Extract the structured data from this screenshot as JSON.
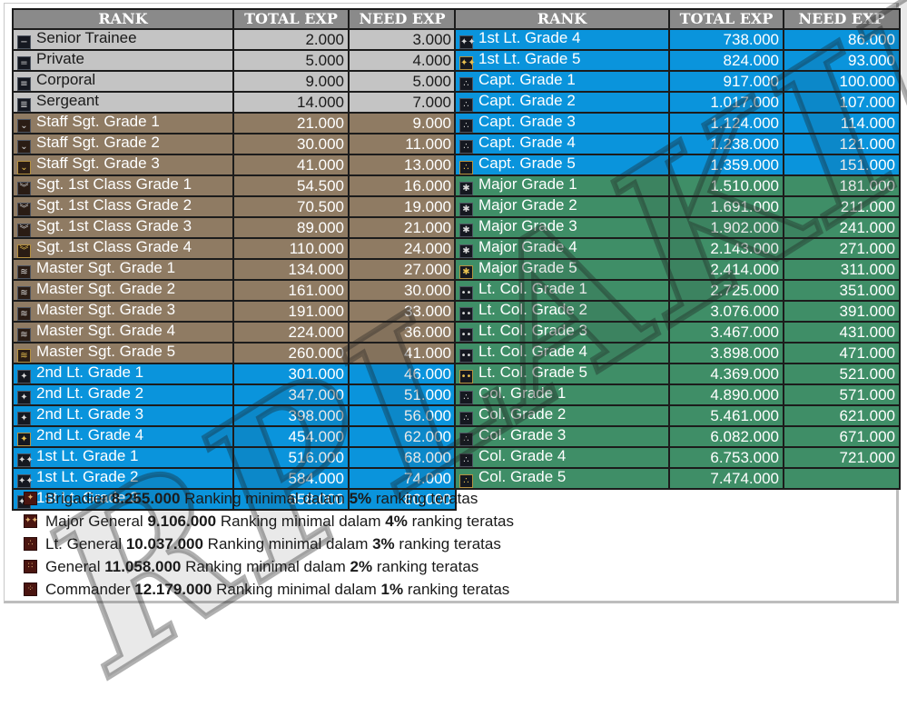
{
  "headers": {
    "rank": "RANK",
    "total_exp": "TOTAL EXP",
    "need_exp": "NEED EXP"
  },
  "colors": {
    "header": "#8a8a8a",
    "enlisted": "#c4c4c4",
    "nco": "#8f7b63",
    "officer": "#0a94dc",
    "field_officer": "#3f8e67",
    "general_icon": "#4a1510"
  },
  "left_table": [
    {
      "rank": "Senior Trainee",
      "total": "2.000",
      "need": "3.000",
      "group": "gray",
      "icon": "bar-1-icon",
      "glyph": "−"
    },
    {
      "rank": "Private",
      "total": "5.000",
      "need": "4.000",
      "group": "gray",
      "icon": "bar-2-icon",
      "glyph": "="
    },
    {
      "rank": "Corporal",
      "total": "9.000",
      "need": "5.000",
      "group": "gray",
      "icon": "bar-3-icon",
      "glyph": "≡"
    },
    {
      "rank": "Sergeant",
      "total": "14.000",
      "need": "7.000",
      "group": "gray",
      "icon": "bar-4-icon",
      "glyph": "≣"
    },
    {
      "rank": "Staff Sgt. Grade 1",
      "total": "21.000",
      "need": "9.000",
      "group": "brown",
      "icon": "chevron-1-icon",
      "glyph": "⌄"
    },
    {
      "rank": "Staff Sgt. Grade 2",
      "total": "30.000",
      "need": "11.000",
      "group": "brown",
      "icon": "chevron-1-icon",
      "glyph": "⌄"
    },
    {
      "rank": "Staff Sgt. Grade 3",
      "total": "41.000",
      "need": "13.000",
      "group": "brown",
      "icon": "chevron-1-gold-icon",
      "glyph": "⌄"
    },
    {
      "rank": "Sgt. 1st Class Grade 1",
      "total": "54.500",
      "need": "16.000",
      "group": "brown",
      "icon": "chevron-2-icon",
      "glyph": "︾"
    },
    {
      "rank": "Sgt. 1st Class Grade 2",
      "total": "70.500",
      "need": "19.000",
      "group": "brown",
      "icon": "chevron-2-icon",
      "glyph": "︾"
    },
    {
      "rank": "Sgt. 1st Class Grade 3",
      "total": "89.000",
      "need": "21.000",
      "group": "brown",
      "icon": "chevron-2-icon",
      "glyph": "︾"
    },
    {
      "rank": "Sgt. 1st Class Grade 4",
      "total": "110.000",
      "need": "24.000",
      "group": "brown",
      "icon": "chevron-2-gold-icon",
      "glyph": "︾"
    },
    {
      "rank": "Master Sgt. Grade 1",
      "total": "134.000",
      "need": "27.000",
      "group": "brown",
      "icon": "chevron-3-icon",
      "glyph": "≋"
    },
    {
      "rank": "Master Sgt. Grade 2",
      "total": "161.000",
      "need": "30.000",
      "group": "brown",
      "icon": "chevron-3-icon",
      "glyph": "≋"
    },
    {
      "rank": "Master Sgt. Grade 3",
      "total": "191.000",
      "need": "33.000",
      "group": "brown",
      "icon": "chevron-3-icon",
      "glyph": "≋"
    },
    {
      "rank": "Master Sgt. Grade 4",
      "total": "224.000",
      "need": "36.000",
      "group": "brown",
      "icon": "chevron-3-icon",
      "glyph": "≋"
    },
    {
      "rank": "Master Sgt. Grade 5",
      "total": "260.000",
      "need": "41.000",
      "group": "brown",
      "icon": "chevron-3-gold-icon",
      "glyph": "≋"
    },
    {
      "rank": "2nd Lt. Grade 1",
      "total": "301.000",
      "need": "46.000",
      "group": "blue",
      "icon": "star-1-icon",
      "glyph": "✦"
    },
    {
      "rank": "2nd Lt. Grade 2",
      "total": "347.000",
      "need": "51.000",
      "group": "blue",
      "icon": "star-1-icon",
      "glyph": "✦"
    },
    {
      "rank": "2nd Lt. Grade 3",
      "total": "398.000",
      "need": "56.000",
      "group": "blue",
      "icon": "star-1-icon",
      "glyph": "✦"
    },
    {
      "rank": "2nd Lt. Grade 4",
      "total": "454.000",
      "need": "62.000",
      "group": "blue",
      "icon": "star-1-gold-icon",
      "glyph": "✦"
    },
    {
      "rank": "1st Lt. Grade 1",
      "total": "516.000",
      "need": "68.000",
      "group": "blue",
      "icon": "star-2-icon",
      "glyph": "✦✦"
    },
    {
      "rank": "1st Lt. Grade 2",
      "total": "584.000",
      "need": "74.000",
      "group": "blue",
      "icon": "star-2-icon",
      "glyph": "✦✦"
    },
    {
      "rank": "1st Lt. Grade 3",
      "total": "658.000",
      "need": "80.000",
      "group": "blue",
      "icon": "star-2-icon",
      "glyph": "✦✦"
    }
  ],
  "right_table": [
    {
      "rank": "1st Lt. Grade 4",
      "total": "738.000",
      "need": "86.000",
      "group": "blue",
      "icon": "star-2-icon",
      "glyph": "✦✦"
    },
    {
      "rank": "1st Lt. Grade 5",
      "total": "824.000",
      "need": "93.000",
      "group": "blue",
      "icon": "star-2-gold-icon",
      "glyph": "✦✦"
    },
    {
      "rank": "Capt. Grade 1",
      "total": "917.000",
      "need": "100.000",
      "group": "blue",
      "icon": "star-3-icon",
      "glyph": "∴"
    },
    {
      "rank": "Capt. Grade 2",
      "total": "1.017.000",
      "need": "107.000",
      "group": "blue",
      "icon": "star-3-icon",
      "glyph": "∴"
    },
    {
      "rank": "Capt. Grade 3",
      "total": "1.124.000",
      "need": "114.000",
      "group": "blue",
      "icon": "star-3-icon",
      "glyph": "∴"
    },
    {
      "rank": "Capt. Grade 4",
      "total": "1.238.000",
      "need": "121.000",
      "group": "blue",
      "icon": "star-3-icon",
      "glyph": "∴"
    },
    {
      "rank": "Capt. Grade 5",
      "total": "1.359.000",
      "need": "151.000",
      "group": "blue",
      "icon": "star-3-gold-icon",
      "glyph": "∴"
    },
    {
      "rank": "Major Grade 1",
      "total": "1.510.000",
      "need": "181.000",
      "group": "green",
      "icon": "sunburst-icon",
      "glyph": "✱"
    },
    {
      "rank": "Major Grade 2",
      "total": "1.691.000",
      "need": "211.000",
      "group": "green",
      "icon": "sunburst-icon",
      "glyph": "✱"
    },
    {
      "rank": "Major Grade 3",
      "total": "1.902.000",
      "need": "241.000",
      "group": "green",
      "icon": "sunburst-icon",
      "glyph": "✱"
    },
    {
      "rank": "Major Grade 4",
      "total": "2.143.000",
      "need": "271.000",
      "group": "green",
      "icon": "sunburst-icon",
      "glyph": "✱"
    },
    {
      "rank": "Major Grade 5",
      "total": "2.414.000",
      "need": "311.000",
      "group": "green",
      "icon": "sunburst-gold-icon",
      "glyph": "✱"
    },
    {
      "rank": "Lt. Col. Grade 1",
      "total": "2.725.000",
      "need": "351.000",
      "group": "green",
      "icon": "double-dot-icon",
      "glyph": "••"
    },
    {
      "rank": "Lt. Col. Grade 2",
      "total": "3.076.000",
      "need": "391.000",
      "group": "green",
      "icon": "double-dot-icon",
      "glyph": "••"
    },
    {
      "rank": "Lt. Col. Grade 3",
      "total": "3.467.000",
      "need": "431.000",
      "group": "green",
      "icon": "double-dot-icon",
      "glyph": "••"
    },
    {
      "rank": "Lt. Col. Grade 4",
      "total": "3.898.000",
      "need": "471.000",
      "group": "green",
      "icon": "double-dot-icon",
      "glyph": "••"
    },
    {
      "rank": "Lt. Col. Grade 5",
      "total": "4.369.000",
      "need": "521.000",
      "group": "green",
      "icon": "double-dot-gold-icon",
      "glyph": "••"
    },
    {
      "rank": "Col. Grade 1",
      "total": "4.890.000",
      "need": "571.000",
      "group": "green",
      "icon": "triple-dot-icon",
      "glyph": "∴"
    },
    {
      "rank": "Col. Grade 2",
      "total": "5.461.000",
      "need": "621.000",
      "group": "green",
      "icon": "triple-dot-icon",
      "glyph": "∴"
    },
    {
      "rank": "Col. Grade 3",
      "total": "6.082.000",
      "need": "671.000",
      "group": "green",
      "icon": "triple-dot-icon",
      "glyph": "∴"
    },
    {
      "rank": "Col. Grade 4",
      "total": "6.753.000",
      "need": "721.000",
      "group": "green",
      "icon": "triple-dot-icon",
      "glyph": "∴"
    },
    {
      "rank": "Col. Grade 5",
      "total": "7.474.000",
      "need": "",
      "group": "green",
      "icon": "triple-dot-gold-icon",
      "glyph": "∴"
    }
  ],
  "generals": [
    {
      "rank": "Brigadier",
      "exp": "8.255.000",
      "text_a": "Ranking minimal dalam",
      "pct": "5%",
      "text_b": "ranking teratas",
      "icon": "general-1-star-icon",
      "glyph": "✦"
    },
    {
      "rank": "Major General",
      "exp": "9.106.000",
      "text_a": "Ranking minimal dalam",
      "pct": "4%",
      "text_b": "ranking teratas",
      "icon": "general-2-star-icon",
      "glyph": "✦✦"
    },
    {
      "rank": "Lt. General",
      "exp": "10.037.000",
      "text_a": "Ranking minimal dalam",
      "pct": "3%",
      "text_b": "ranking teratas",
      "icon": "general-3-star-icon",
      "glyph": "∴"
    },
    {
      "rank": "General",
      "exp": "11.058.000",
      "text_a": "Ranking minimal dalam",
      "pct": "2%",
      "text_b": "ranking teratas",
      "icon": "general-4-star-icon",
      "glyph": "∷"
    },
    {
      "rank": "Commander",
      "exp": "12.179.000",
      "text_a": "Ranking minimal dalam",
      "pct": "1%",
      "text_b": "ranking teratas",
      "icon": "commander-icon",
      "glyph": "⁘"
    }
  ],
  "watermark": "RPLAKIRZ"
}
